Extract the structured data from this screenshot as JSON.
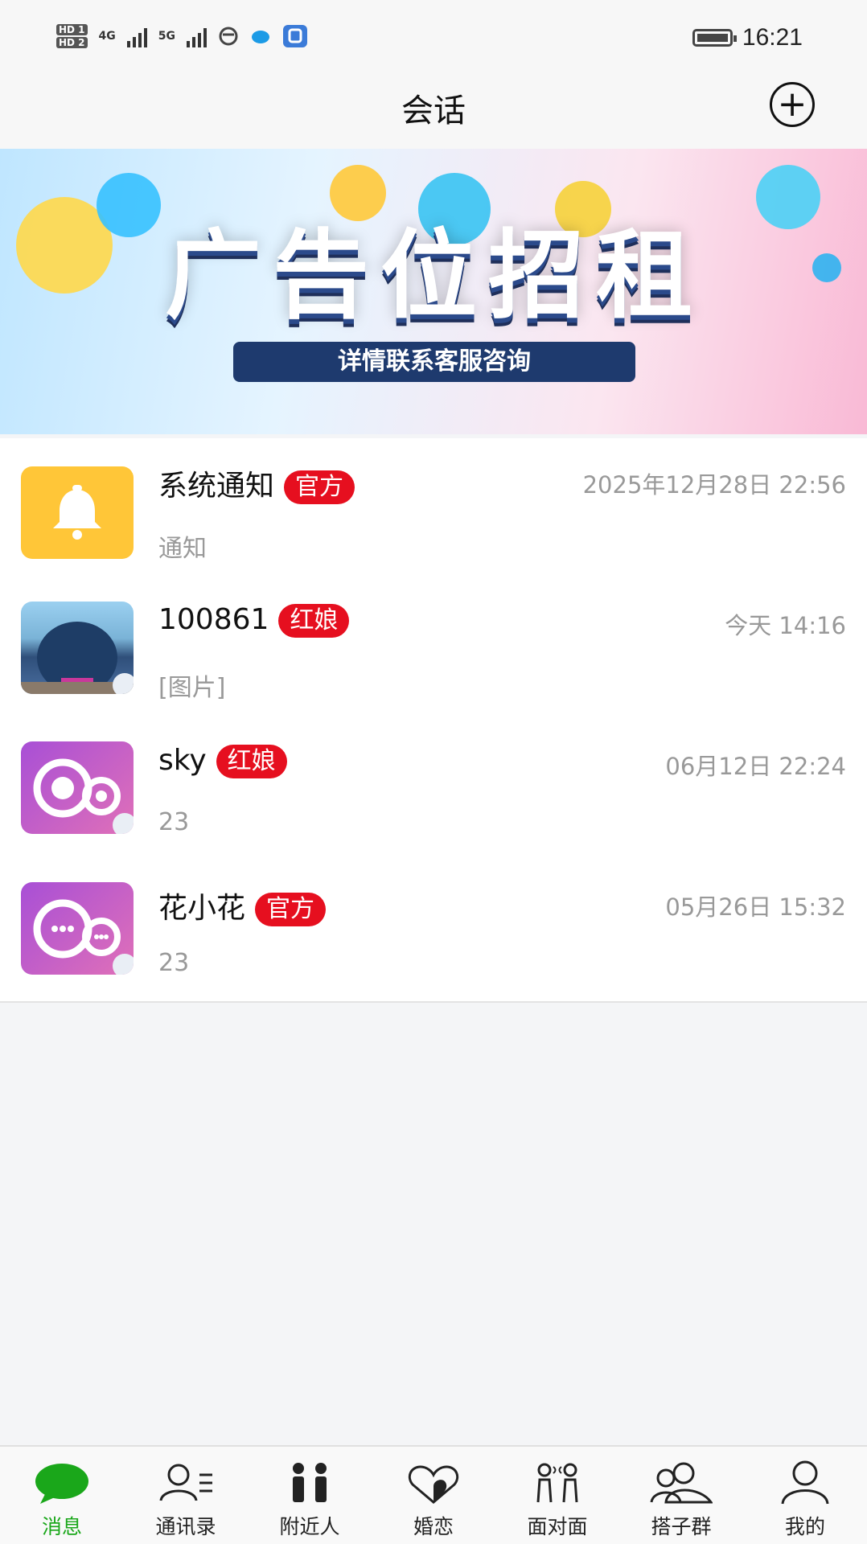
{
  "status_bar": {
    "time": "16:21",
    "hd1": "HD 1",
    "hd2": "HD 2",
    "net1": "4G",
    "net2": "5G"
  },
  "header": {
    "title": "会话",
    "add_icon": "plus-circle-icon"
  },
  "banner": {
    "headline": "广告位招租",
    "subline": "详情联系客服咨询",
    "slide_count": 3,
    "active_slide": 3
  },
  "conversations": [
    {
      "name": "系统通知",
      "badge": "官方",
      "time": "2025年12月28日 22:56",
      "preview": "通知",
      "avatar": "bell-icon"
    },
    {
      "name": "100861",
      "badge": "红娘",
      "time": "今天 14:16",
      "preview": "[图片]",
      "avatar": "photo-avatar"
    },
    {
      "name": "sky",
      "badge": "红娘",
      "time": "06月12日 22:24",
      "preview": "23",
      "avatar": "flower-logo-icon"
    },
    {
      "name": "花小花",
      "badge": "官方",
      "time": "05月26日 15:32",
      "preview": "23",
      "avatar": "chat-logo-icon"
    }
  ],
  "tabs": [
    {
      "label": "消息",
      "icon": "chat-bubble-icon",
      "active": true
    },
    {
      "label": "通讯录",
      "icon": "contacts-icon",
      "active": false
    },
    {
      "label": "附近人",
      "icon": "nearby-people-icon",
      "active": false
    },
    {
      "label": "婚恋",
      "icon": "hearts-icon",
      "active": false
    },
    {
      "label": "面对面",
      "icon": "face-to-face-icon",
      "active": false
    },
    {
      "label": "搭子群",
      "icon": "group-icon",
      "active": false
    },
    {
      "label": "我的",
      "icon": "profile-icon",
      "active": false
    }
  ],
  "colors": {
    "accent_green": "#1aa71a",
    "badge_red": "#e60f1f",
    "bell_yellow": "#ffc638"
  }
}
